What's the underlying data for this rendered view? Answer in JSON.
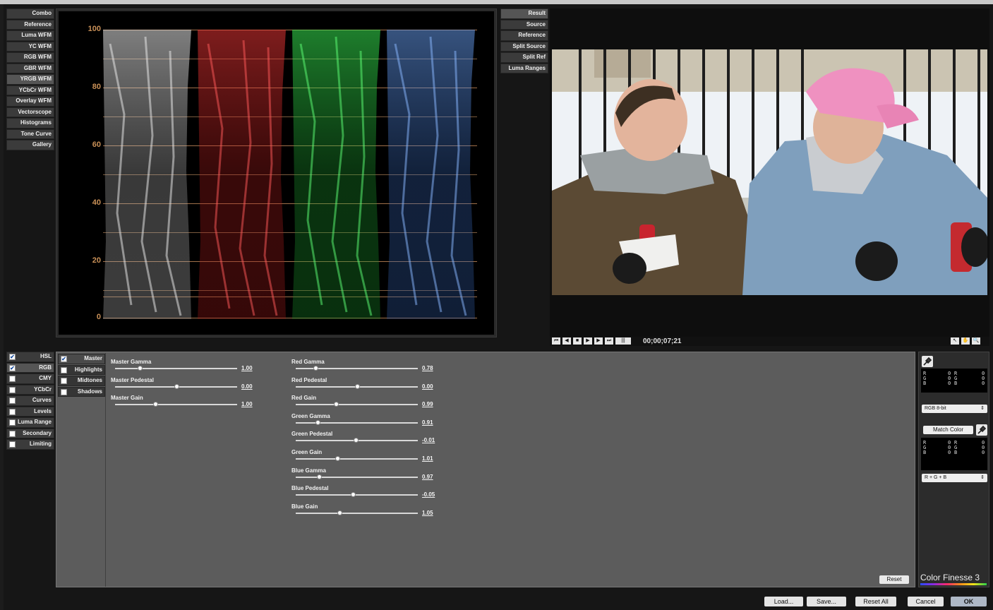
{
  "app": {
    "brand": "Color Finesse 3"
  },
  "view_buttons": [
    "Combo",
    "Reference",
    "Luma WFM",
    "YC WFM",
    "RGB WFM",
    "GBR WFM",
    "YRGB WFM",
    "YCbCr WFM",
    "Overlay WFM",
    "Vectorscope",
    "Histograms",
    "Tone Curve",
    "Gallery"
  ],
  "scope": {
    "y_labels": [
      "100",
      "80",
      "60",
      "40",
      "20",
      "0"
    ]
  },
  "result_buttons": [
    "Result",
    "Source",
    "Reference",
    "Split Source",
    "Split Ref",
    "Luma Ranges"
  ],
  "transport": {
    "timecode": "00;00;07;21",
    "icons": [
      "goto-start-icon",
      "step-back-icon",
      "stop-icon",
      "play-icon",
      "step-forward-icon",
      "goto-end-icon",
      "loop-icon"
    ]
  },
  "categories": [
    {
      "label": "HSL",
      "checked": true
    },
    {
      "label": "RGB",
      "checked": true
    },
    {
      "label": "CMY",
      "checked": false
    },
    {
      "label": "YCbCr",
      "checked": false
    },
    {
      "label": "Curves",
      "checked": false
    },
    {
      "label": "Levels",
      "checked": false
    },
    {
      "label": "Luma Range",
      "checked": false
    },
    {
      "label": "Secondary",
      "checked": false
    },
    {
      "label": "Limiting",
      "checked": false
    }
  ],
  "ranges": [
    {
      "label": "Master",
      "checked": true
    },
    {
      "label": "Highlights",
      "checked": false
    },
    {
      "label": "Midtones",
      "checked": false
    },
    {
      "label": "Shadows",
      "checked": false
    }
  ],
  "master_params": [
    {
      "label": "Master Gamma",
      "value": "1.00",
      "pos": 0.2
    },
    {
      "label": "Master Pedestal",
      "value": "0.00",
      "pos": 0.5
    },
    {
      "label": "Master Gain",
      "value": "1.00",
      "pos": 0.33
    }
  ],
  "channel_params": [
    {
      "label": "Red Gamma",
      "value": "0.78",
      "pos": 0.16
    },
    {
      "label": "Red Pedestal",
      "value": "0.00",
      "pos": 0.5
    },
    {
      "label": "Red Gain",
      "value": "0.99",
      "pos": 0.33
    },
    {
      "label": "Green Gamma",
      "value": "0.91",
      "pos": 0.18
    },
    {
      "label": "Green Pedestal",
      "value": "-0.01",
      "pos": 0.49
    },
    {
      "label": "Green Gain",
      "value": "1.01",
      "pos": 0.34
    },
    {
      "label": "Blue Gamma",
      "value": "0.97",
      "pos": 0.19
    },
    {
      "label": "Blue Pedestal",
      "value": "-0.05",
      "pos": 0.47
    },
    {
      "label": "Blue Gain",
      "value": "1.05",
      "pos": 0.36
    }
  ],
  "panel": {
    "reset_label": "Reset"
  },
  "info": {
    "readout1": {
      "left": [
        "R",
        "G",
        "B"
      ],
      "v1": [
        "0",
        "0",
        "0"
      ],
      "mid": [
        "R",
        "G",
        "B"
      ],
      "v2": [
        "0",
        "0",
        "0"
      ]
    },
    "select1": "RGB 8-bit",
    "match_label": "Match Color",
    "readout2": {
      "left": [
        "R",
        "G",
        "B"
      ],
      "v1": [
        "0",
        "0",
        "0"
      ],
      "mid": [
        "R",
        "G",
        "B"
      ],
      "v2": [
        "0",
        "0",
        "0"
      ]
    },
    "select2": "R + G + B"
  },
  "footer": [
    "Load...",
    "Save...",
    "Reset All",
    "Cancel",
    "OK"
  ]
}
